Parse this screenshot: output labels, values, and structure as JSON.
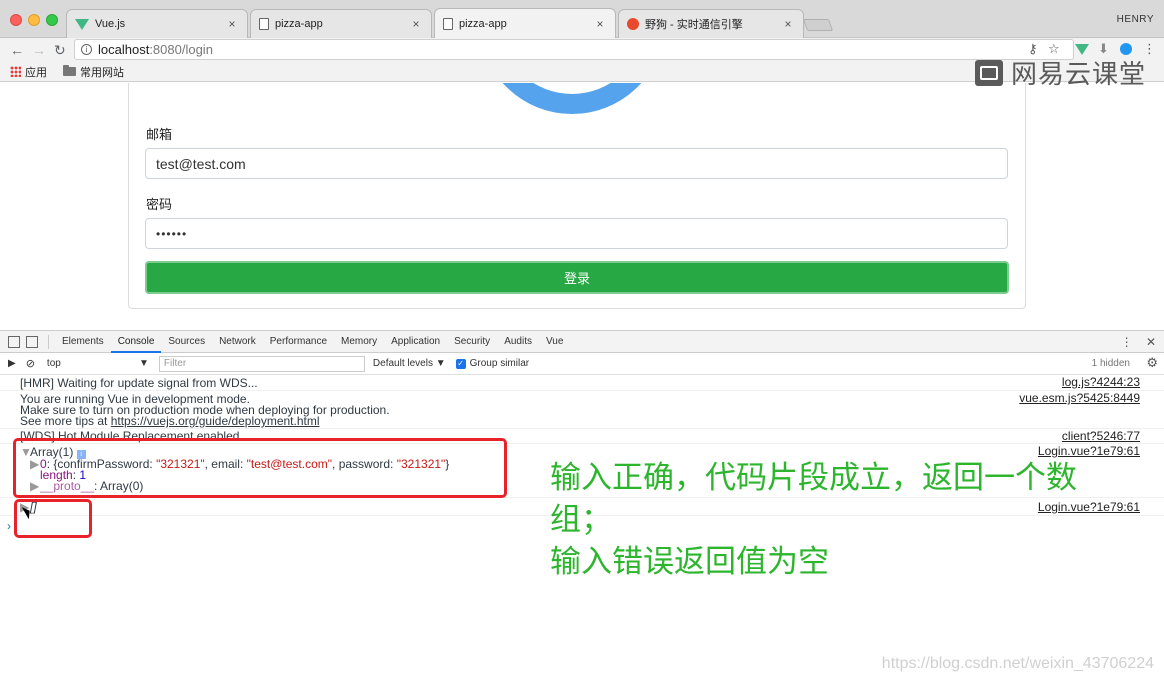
{
  "browser": {
    "tabs": [
      {
        "title": "Vue.js",
        "favicon": "vue-icon",
        "active": false
      },
      {
        "title": "pizza-app",
        "favicon": "document-icon",
        "active": false
      },
      {
        "title": "pizza-app",
        "favicon": "document-icon",
        "active": true
      },
      {
        "title": "野狗 - 实时通信引擎",
        "favicon": "wilddog-icon",
        "active": false
      }
    ],
    "close_glyph": "×",
    "profile": "HENRY",
    "url_host": "localhost",
    "url_path": ":8080/login",
    "bookmarks": [
      {
        "label": "应用",
        "icon": "apps-grid-icon"
      },
      {
        "label": "常用网站",
        "icon": "folder-icon"
      }
    ]
  },
  "watermark_top": "网易云课堂",
  "login_form": {
    "email_label": "邮箱",
    "email_value": "test@test.com",
    "password_label": "密码",
    "password_value": "••••••",
    "submit_label": "登录"
  },
  "devtools": {
    "tabs": [
      "Elements",
      "Console",
      "Sources",
      "Network",
      "Performance",
      "Memory",
      "Application",
      "Security",
      "Audits",
      "Vue"
    ],
    "active_tab": "Console",
    "context": "top",
    "filter_placeholder": "Filter",
    "levels": "Default levels ▼",
    "group_similar": "Group similar",
    "hidden_count": "1 hidden"
  },
  "console": {
    "hmr_msg": "[HMR] Waiting for update signal from WDS...",
    "hmr_src": "log.js?4244:23",
    "vue_msg_1": "You are running Vue in development mode.",
    "vue_msg_2": "Make sure to turn on production mode when deploying for production.",
    "vue_msg_3_prefix": "See more tips at ",
    "vue_msg_3_link": "https://vuejs.org/guide/deployment.html",
    "vue_src": "vue.esm.js?5425:8449",
    "wds_msg": "[WDS] Hot Module Replacement enabled.",
    "wds_src": "client?5246:77",
    "array_header": "Array(1)",
    "array_item_index": "0",
    "array_item_obj_open": "{confirmPassword: ",
    "array_item_cp": "\"321321\"",
    "array_item_email_key": ", email: ",
    "array_item_email": "\"test@test.com\"",
    "array_item_pw_key": ", password: ",
    "array_item_pw": "\"321321\"",
    "array_item_close": "}",
    "length_key": "length",
    "length_val": "1",
    "proto_key": "__proto__",
    "proto_val": ": Array(0)",
    "array_src": "Login.vue?1e79:61",
    "empty_array": "[]",
    "empty_src": "Login.vue?1e79:61"
  },
  "annotation": {
    "line1": "输入正确，代码片段成立，返回一个数组；",
    "line2": "输入错误返回值为空"
  },
  "watermark_bottom": "https://blog.csdn.net/weixin_43706224",
  "colors": {
    "submit_button": "#28a745",
    "annotation_text": "#2db52d",
    "highlight_box": "#e8222a",
    "logo_ring": "#54a3ec"
  }
}
